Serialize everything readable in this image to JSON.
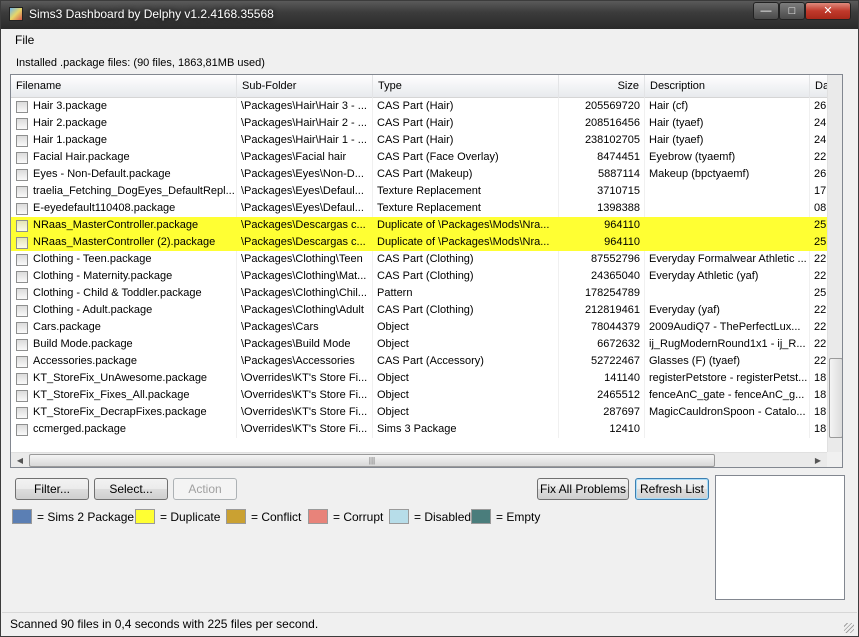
{
  "window": {
    "title": "Sims3 Dashboard by Delphy v1.2.4168.35568",
    "minimize_glyph": "—",
    "maximize_glyph": "□",
    "close_glyph": "✕"
  },
  "menu": {
    "file": "File"
  },
  "installed_label": "Installed .package files: (90 files, 1863,81MB used)",
  "columns": [
    "Filename",
    "Sub-Folder",
    "Type",
    "Size",
    "Description",
    "Da"
  ],
  "rows": [
    {
      "filename": "Hair 3.package",
      "subfolder": "\\Packages\\Hair\\Hair 3 - ...",
      "type": "CAS Part (Hair)",
      "size": "205569720",
      "description": "Hair (cf)",
      "date": "26",
      "highlight": "none"
    },
    {
      "filename": "Hair 2.package",
      "subfolder": "\\Packages\\Hair\\Hair 2 - ...",
      "type": "CAS Part (Hair)",
      "size": "208516456",
      "description": "Hair (tyaef)",
      "date": "24",
      "highlight": "none"
    },
    {
      "filename": "Hair 1.package",
      "subfolder": "\\Packages\\Hair\\Hair 1 - ...",
      "type": "CAS Part (Hair)",
      "size": "238102705",
      "description": "Hair (tyaef)",
      "date": "24",
      "highlight": "none"
    },
    {
      "filename": "Facial Hair.package",
      "subfolder": "\\Packages\\Facial hair",
      "type": "CAS Part (Face Overlay)",
      "size": "8474451",
      "description": "Eyebrow (tyaemf)",
      "date": "22",
      "highlight": "none"
    },
    {
      "filename": "Eyes - Non-Default.package",
      "subfolder": "\\Packages\\Eyes\\Non-D...",
      "type": "CAS Part (Makeup)",
      "size": "5887114",
      "description": "Makeup (bpctyaemf)",
      "date": "26",
      "highlight": "none"
    },
    {
      "filename": "traelia_Fetching_DogEyes_DefaultRepl...",
      "subfolder": "\\Packages\\Eyes\\Defaul...",
      "type": "Texture Replacement",
      "size": "3710715",
      "description": "",
      "date": "17",
      "highlight": "none"
    },
    {
      "filename": "E-eyedefault110408.package",
      "subfolder": "\\Packages\\Eyes\\Defaul...",
      "type": "Texture Replacement",
      "size": "1398388",
      "description": "",
      "date": "08",
      "highlight": "none"
    },
    {
      "filename": "NRaas_MasterController.package",
      "subfolder": "\\Packages\\Descargas c...",
      "type": "Duplicate of \\Packages\\Mods\\Nra...",
      "size": "964110",
      "description": "",
      "date": "25",
      "highlight": "duplicate"
    },
    {
      "filename": "NRaas_MasterController (2).package",
      "subfolder": "\\Packages\\Descargas c...",
      "type": "Duplicate of \\Packages\\Mods\\Nra...",
      "size": "964110",
      "description": "",
      "date": "25",
      "highlight": "duplicate"
    },
    {
      "filename": "Clothing - Teen.package",
      "subfolder": "\\Packages\\Clothing\\Teen",
      "type": "CAS Part (Clothing)",
      "size": "87552796",
      "description": "Everyday Formalwear Athletic ...",
      "date": "22",
      "highlight": "none"
    },
    {
      "filename": "Clothing - Maternity.package",
      "subfolder": "\\Packages\\Clothing\\Mat...",
      "type": "CAS Part (Clothing)",
      "size": "24365040",
      "description": "Everyday Athletic  (yaf)",
      "date": "22",
      "highlight": "none"
    },
    {
      "filename": "Clothing - Child & Toddler.package",
      "subfolder": "\\Packages\\Clothing\\Chil...",
      "type": "Pattern",
      "size": "178254789",
      "description": "",
      "date": "25",
      "highlight": "none"
    },
    {
      "filename": "Clothing - Adult.package",
      "subfolder": "\\Packages\\Clothing\\Adult",
      "type": "CAS Part (Clothing)",
      "size": "212819461",
      "description": "Everyday  (yaf)",
      "date": "22",
      "highlight": "none"
    },
    {
      "filename": "Cars.package",
      "subfolder": "\\Packages\\Cars",
      "type": "Object",
      "size": "78044379",
      "description": "2009AudiQ7 - ThePerfectLux...",
      "date": "22",
      "highlight": "none"
    },
    {
      "filename": "Build Mode.package",
      "subfolder": "\\Packages\\Build Mode",
      "type": "Object",
      "size": "6672632",
      "description": "ij_RugModernRound1x1 - ij_R...",
      "date": "22",
      "highlight": "none"
    },
    {
      "filename": "Accessories.package",
      "subfolder": "\\Packages\\Accessories",
      "type": "CAS Part (Accessory)",
      "size": "52722467",
      "description": "Glasses (F) (tyaef)",
      "date": "22",
      "highlight": "none"
    },
    {
      "filename": "KT_StoreFix_UnAwesome.package",
      "subfolder": "\\Overrides\\KT's Store Fi...",
      "type": "Object",
      "size": "141140",
      "description": "registerPetstore - registerPetst...",
      "date": "18",
      "highlight": "none"
    },
    {
      "filename": "KT_StoreFix_Fixes_All.package",
      "subfolder": "\\Overrides\\KT's Store Fi...",
      "type": "Object",
      "size": "2465512",
      "description": "fenceAnC_gate - fenceAnC_g...",
      "date": "18",
      "highlight": "none"
    },
    {
      "filename": "KT_StoreFix_DecrapFixes.package",
      "subfolder": "\\Overrides\\KT's Store Fi...",
      "type": "Object",
      "size": "287697",
      "description": "MagicCauldronSpoon - Catalo...",
      "date": "18",
      "highlight": "none"
    },
    {
      "filename": "ccmerged.package",
      "subfolder": "\\Overrides\\KT's Store Fi...",
      "type": "Sims 3 Package",
      "size": "12410",
      "description": "",
      "date": "18",
      "highlight": "none"
    }
  ],
  "scrollbar": {
    "left_arrow": "◀",
    "right_arrow": "▶",
    "grip": "|||"
  },
  "buttons": {
    "filter": "Filter...",
    "select": "Select...",
    "action": "Action",
    "fix_all": "Fix All Problems",
    "refresh": "Refresh List"
  },
  "legend": [
    {
      "label": "= Sims 2 Package",
      "color": "#5b7fb4"
    },
    {
      "label": "= Duplicate",
      "color": "#ffff33"
    },
    {
      "label": "= Conflict",
      "color": "#caa132"
    },
    {
      "label": "= Corrupt",
      "color": "#e8837a"
    },
    {
      "label": "= Disabled",
      "color": "#b7dde9"
    },
    {
      "label": "= Empty",
      "color": "#4a7d7c"
    }
  ],
  "status": "Scanned 90 files in 0,4 seconds with 225 files per second."
}
